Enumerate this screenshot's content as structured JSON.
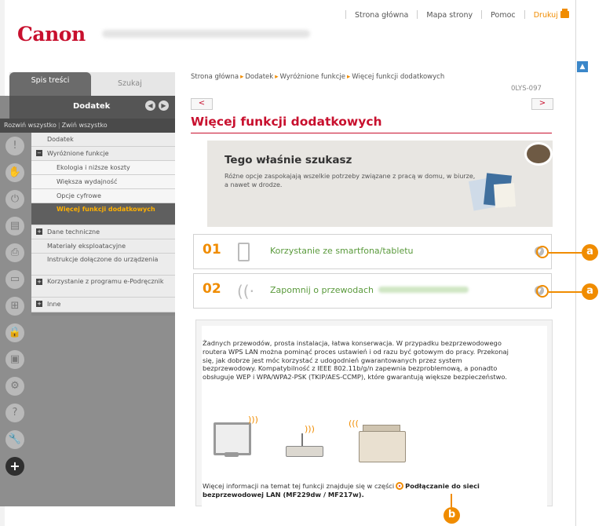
{
  "header": {
    "brand": "Canon",
    "links": [
      "Strona główna",
      "Mapa strony",
      "Pomoc"
    ],
    "print_label": "Drukuj",
    "scroll_top_symbol": "▲"
  },
  "sidebar": {
    "tabs": [
      "Spis treści",
      "Szukaj"
    ],
    "section_title": "Dodatek",
    "nav_prev": "◀",
    "nav_next": "▶",
    "expand_all": "Rozwiń wszystko",
    "collapse_all": "Zwiń wszystko",
    "tree": [
      {
        "label": "Dodatek"
      },
      {
        "label": "Wyróżnione funkcje",
        "toggle": "−"
      },
      {
        "label": "Ekologia i niższe koszty"
      },
      {
        "label": "Większa wydajność"
      },
      {
        "label": "Opcje cyfrowe"
      },
      {
        "label": "Więcej funkcji dodatkowych"
      },
      {
        "label": "Dane techniczne",
        "toggle": "+"
      },
      {
        "label": "Materiały eksploatacyjne"
      },
      {
        "label": "Instrukcje dołączone do urządzenia"
      },
      {
        "label": "Korzystanie z programu e-Podręcznik",
        "toggle": "+"
      },
      {
        "label": "Inne",
        "toggle": "+"
      }
    ],
    "icons": [
      "warning-icon",
      "hand-icon",
      "power-icon",
      "copy-icon",
      "print-icon",
      "scan-icon",
      "network-icon",
      "lock-icon",
      "device-icon",
      "settings-icon",
      "help-icon",
      "wrench-icon",
      "plus-icon"
    ],
    "active_icon_symbol": "+"
  },
  "breadcrumb": [
    "Strona główna",
    "Dodatek",
    "Wyróżnione funkcje",
    "Więcej funkcji dodatkowych"
  ],
  "doc_id": "0LYS-097",
  "pager": {
    "prev": "<",
    "next": ">"
  },
  "page_title": "Więcej funkcji dodatkowych",
  "banner": {
    "title": "Tego właśnie szukasz",
    "desc": "Różne opcje zaspokajają wszelkie potrzeby związane z pracą w domu, w biurze, a nawet w drodze."
  },
  "features": [
    {
      "num": "01",
      "label": "Korzystanie ze smartfona/tabletu",
      "expand": "▼",
      "callout": "a"
    },
    {
      "num": "02",
      "label": "Zapomnij o przewodach",
      "expand": "▼",
      "callout": "a"
    }
  ],
  "detail": {
    "paragraph": "Żadnych przewodów, prosta instalacja, łatwa konserwacja. W przypadku bezprzewodowego routera WPS LAN można pominąć proces ustawień i od razu być gotowym do pracy. Przekonaj się, jak dobrze jest móc korzystać z udogodnień gwarantowanych przez system bezprzewodowy. Kompatybilność z IEEE 802.11b/g/n zapewnia bezproblemową, a ponadto obsługuje WEP i WPA/WPA2-PSK (TKIP/AES-CCMP), które gwarantują większe bezpieczeństwo.",
    "more_prefix": "Więcej informacji na temat tej funkcji znajduje się w części",
    "more_link": "Podłączanie do sieci bezprzewodowej LAN (MF229dw / MF217w).",
    "callout": "b"
  },
  "colors": {
    "brand_red": "#c8102e",
    "accent_orange": "#f08c00",
    "feature_green": "#5a9a3c"
  }
}
